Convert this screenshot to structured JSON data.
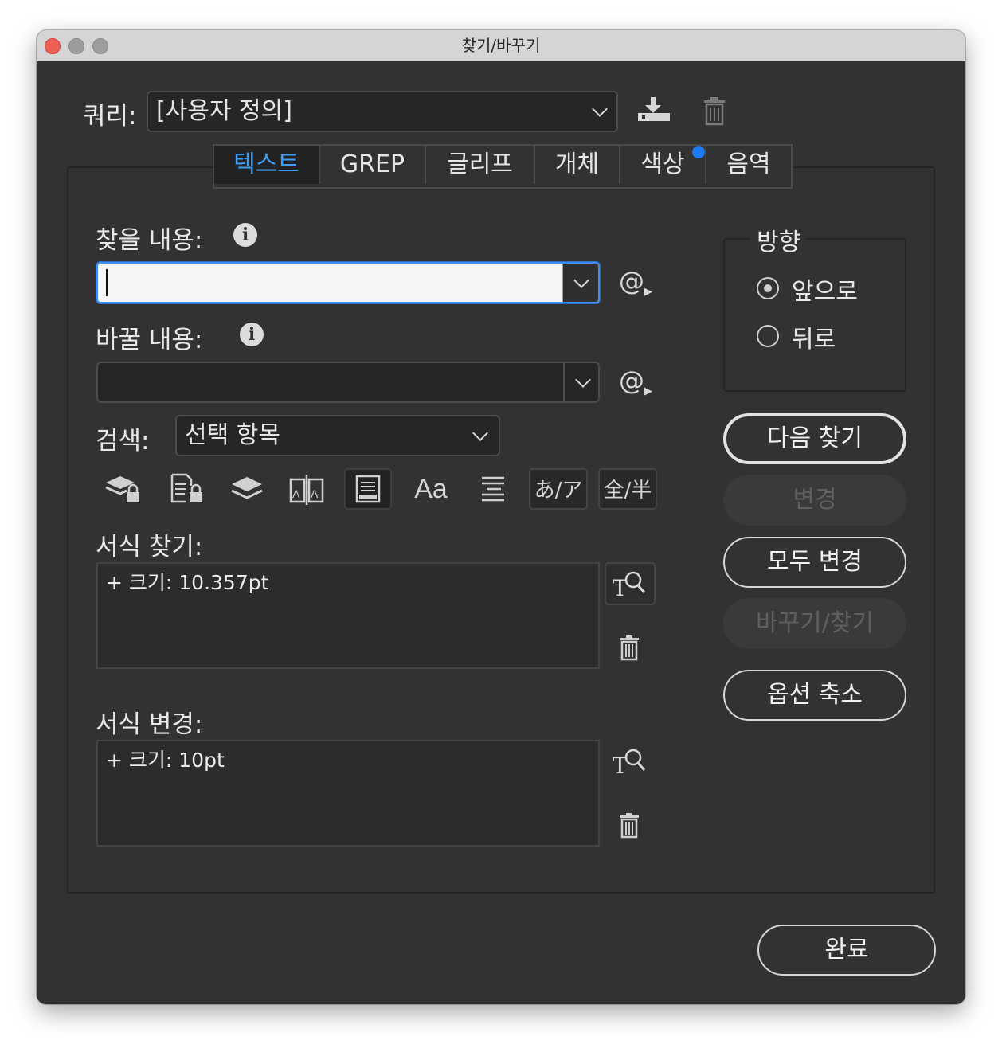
{
  "window": {
    "title": "찾기/바꾸기"
  },
  "query": {
    "label": "쿼리:",
    "value": "[사용자 정의]",
    "save_icon": "save-query-icon",
    "delete_icon": "trash-icon"
  },
  "tabs": [
    {
      "label": "텍스트",
      "active": true
    },
    {
      "label": "GREP"
    },
    {
      "label": "글리프"
    },
    {
      "label": "개체"
    },
    {
      "label": "색상",
      "badge": true
    },
    {
      "label": "음역"
    }
  ],
  "find": {
    "label": "찾을 내용:",
    "value": "",
    "special_char_button": "@"
  },
  "change": {
    "label": "바꿀 내용:",
    "value": "",
    "special_char_button": "@"
  },
  "search": {
    "label": "검색:",
    "value": "선택 항목"
  },
  "options_icons": [
    {
      "name": "include-locked-layers-icon"
    },
    {
      "name": "include-locked-stories-icon"
    },
    {
      "name": "include-hidden-layers-icon"
    },
    {
      "name": "include-master-pages-icon"
    },
    {
      "name": "include-footnotes-icon",
      "selected": true
    },
    {
      "name": "case-sensitive-icon",
      "text": "Aa"
    },
    {
      "name": "whole-word-icon"
    },
    {
      "name": "kana-sensitive-icon",
      "text": "あ/ア"
    },
    {
      "name": "full-half-width-icon",
      "text": "全/半"
    }
  ],
  "find_format": {
    "label": "서식 찾기:",
    "value": "+ 크기: 10.357pt"
  },
  "change_format": {
    "label": "서식 변경:",
    "value": "+ 크기: 10pt"
  },
  "direction": {
    "label": "방향",
    "options": [
      {
        "label": "앞으로",
        "selected": true
      },
      {
        "label": "뒤로",
        "selected": false
      }
    ]
  },
  "buttons": {
    "find_next": "다음 찾기",
    "change": "변경",
    "change_all": "모두 변경",
    "change_find": "바꾸기/찾기",
    "fewer_options": "옵션 축소",
    "done": "완료"
  },
  "colors": {
    "background": "#323232",
    "accent": "#3d9df5",
    "badge": "#1e7cf0"
  }
}
